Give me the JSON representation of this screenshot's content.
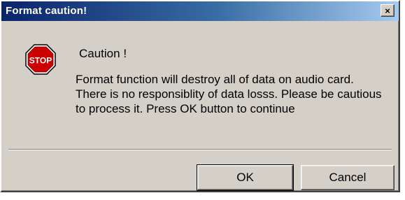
{
  "window": {
    "title": "Format caution!",
    "close_glyph": "×"
  },
  "icon": {
    "name": "stop-icon",
    "text": "STOP",
    "color": "#cc0000"
  },
  "content": {
    "heading": "Caution !",
    "message": "Format function will destroy all of data on audio card. There is no responsiblity of data losss. Please be cautious to process it. Press OK button to continue"
  },
  "buttons": {
    "ok_label": "OK",
    "cancel_label": "Cancel"
  },
  "colors": {
    "face": "#d4d0c8",
    "title_start": "#0a246a",
    "title_end": "#a6caf0"
  }
}
